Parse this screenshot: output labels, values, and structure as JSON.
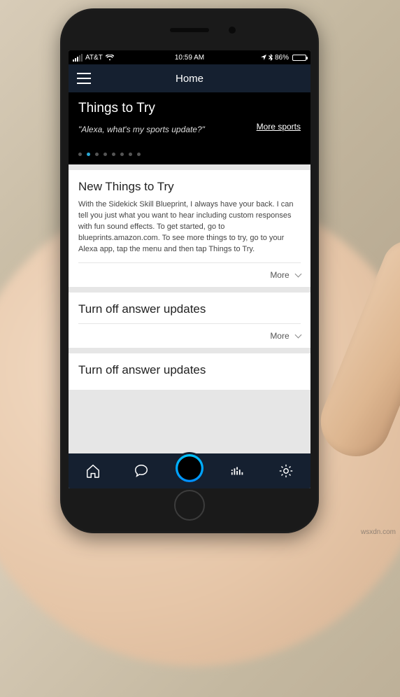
{
  "statusbar": {
    "carrier": "AT&T",
    "wifi_icon": "wifi",
    "time": "10:59 AM",
    "location_icon": "location-arrow",
    "bluetooth_icon": "bluetooth",
    "battery_pct": "86%",
    "battery_fill_color": "#4cd964"
  },
  "appbar": {
    "menu_icon": "hamburger",
    "title": "Home"
  },
  "hero": {
    "title": "Things to Try",
    "quote": "\"Alexa, what's my sports update?\"",
    "link_label": "More sports",
    "page_dots_total": 8,
    "page_dots_active_index": 1
  },
  "cards": [
    {
      "title": "New Things to Try",
      "body": "With the Sidekick Skill Blueprint, I always have your back. I can tell you just what you want to hear including custom responses with fun sound effects. To get started, go to blueprints.amazon.com. To see more things to try, go to your Alexa app, tap the menu and then tap Things to Try.",
      "more_label": "More"
    },
    {
      "title": "Turn off answer updates",
      "body": "",
      "more_label": "More"
    },
    {
      "title": "Turn off answer updates",
      "body": "",
      "more_label": ""
    }
  ],
  "bottomnav": {
    "items": [
      {
        "name": "home",
        "icon": "home-outline"
      },
      {
        "name": "communicate",
        "icon": "chat-bubble"
      },
      {
        "name": "alexa",
        "icon": "alexa-ring"
      },
      {
        "name": "music",
        "icon": "equalizer"
      },
      {
        "name": "settings",
        "icon": "gear-dots"
      }
    ]
  },
  "watermark": "wsxdn.com"
}
